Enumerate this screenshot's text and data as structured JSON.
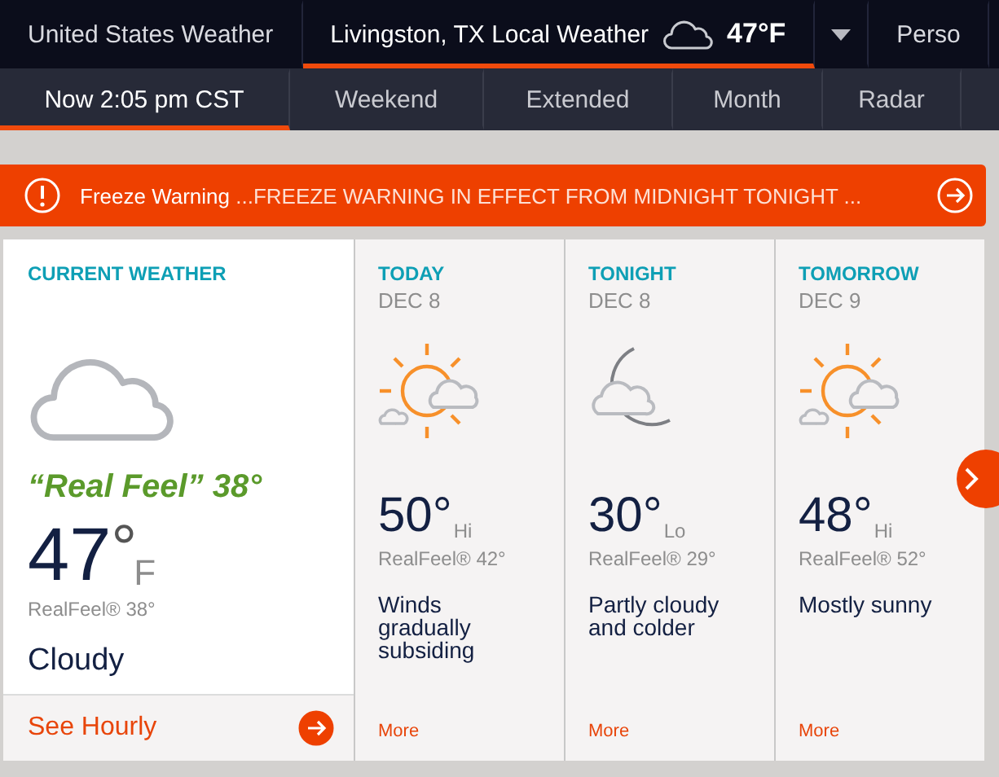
{
  "top_nav": [
    {
      "kind": "link",
      "label": "United States Weather",
      "selected": false
    },
    {
      "kind": "location",
      "label": "Livingston, TX Local Weather",
      "temp": "47°F",
      "selected": true
    },
    {
      "kind": "dropdown",
      "selected": false
    },
    {
      "kind": "link",
      "label": "Perso",
      "selected": false
    }
  ],
  "tabs": [
    {
      "label": "Now 2:05 pm CST",
      "selected": true
    },
    {
      "label": "Weekend",
      "selected": false
    },
    {
      "label": "Extended",
      "selected": false
    },
    {
      "label": "Month",
      "selected": false
    },
    {
      "label": "Radar",
      "selected": false
    }
  ],
  "alert": {
    "title": "Freeze Warning",
    "text": "...FREEZE WARNING IN EFFECT FROM MIDNIGHT TONIGHT ..."
  },
  "current": {
    "heading": "CURRENT WEATHER",
    "kind": "cloud",
    "real_feel_quote": "“Real Feel” 38°",
    "temp": "47",
    "degree": "°",
    "unit": "F",
    "real_feel": "RealFeel® 38°",
    "phrase": "Cloudy",
    "link": "See Hourly"
  },
  "forecast": [
    {
      "heading": "TODAY",
      "date": "DEC 8",
      "kind": "sun-cloud",
      "temp": "50°",
      "hilo": "Hi",
      "real_feel": "RealFeel® 42°",
      "phrase": "Winds gradually subsiding",
      "more": "More"
    },
    {
      "heading": "TONIGHT",
      "date": "DEC 8",
      "kind": "moon-cloud",
      "temp": "30°",
      "hilo": "Lo",
      "real_feel": "RealFeel® 29°",
      "phrase": "Partly cloudy and colder",
      "more": "More"
    },
    {
      "heading": "TOMORROW",
      "date": "DEC 9",
      "kind": "sun-cloud",
      "temp": "48°",
      "hilo": "Hi",
      "real_feel": "RealFeel® 52°",
      "phrase": "Mostly sunny",
      "more": "More"
    }
  ]
}
